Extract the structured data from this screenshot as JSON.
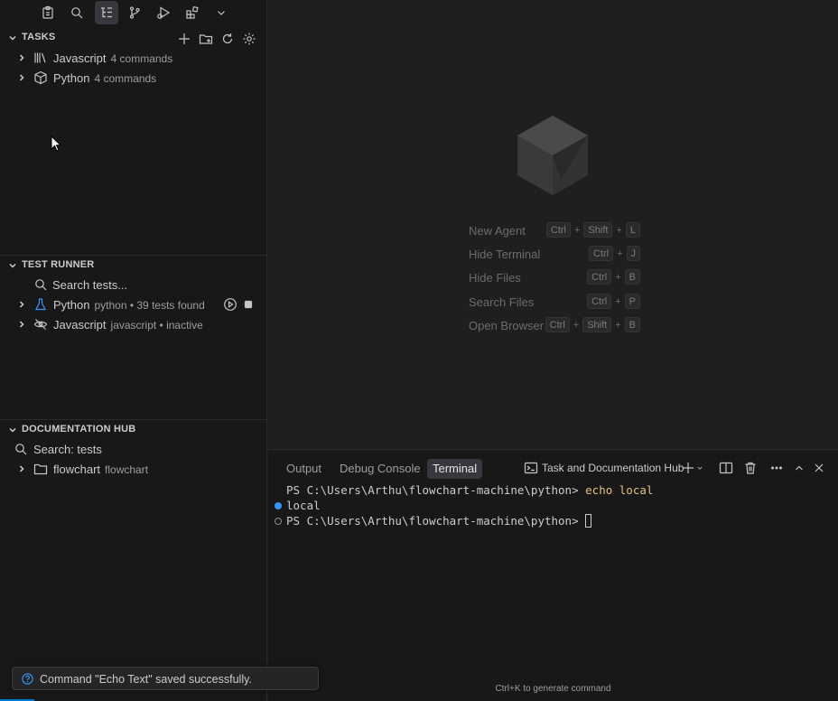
{
  "activity_bar": {
    "icons": [
      "clipboard-icon",
      "search-icon",
      "list-tree-icon",
      "source-control-icon",
      "run-debug-icon",
      "extensions-icon",
      "chevron-down-icon"
    ],
    "active": "list-tree-icon"
  },
  "tasks": {
    "title": "TASKS",
    "actions": [
      "add-icon",
      "new-folder-icon",
      "refresh-icon",
      "gear-icon"
    ],
    "items": [
      {
        "label": "Javascript",
        "desc": "4 commands",
        "icon": "library-icon"
      },
      {
        "label": "Python",
        "desc": "4 commands",
        "icon": "package-icon"
      }
    ]
  },
  "test_runner": {
    "title": "TEST RUNNER",
    "search_label": "Search tests...",
    "items": [
      {
        "label": "Python",
        "desc": "python • 39 tests found",
        "icon": "beaker-icon"
      },
      {
        "label": "Javascript",
        "desc": "javascript • inactive",
        "icon": "eye-closed-icon"
      }
    ]
  },
  "documentation_hub": {
    "title": "DOCUMENTATION HUB",
    "search_label": "Search: tests",
    "items": [
      {
        "label": "flowchart",
        "desc": "flowchart",
        "icon": "folder-icon"
      }
    ]
  },
  "watermark": {
    "shortcuts": [
      {
        "label": "New Agent",
        "keys": [
          "Ctrl",
          "Shift",
          "L"
        ]
      },
      {
        "label": "Hide Terminal",
        "keys": [
          "Ctrl",
          "J"
        ]
      },
      {
        "label": "Hide Files",
        "keys": [
          "Ctrl",
          "B"
        ]
      },
      {
        "label": "Search Files",
        "keys": [
          "Ctrl",
          "P"
        ]
      },
      {
        "label": "Open Browser",
        "keys": [
          "Ctrl",
          "Shift",
          "B"
        ]
      }
    ],
    "plus": "+"
  },
  "panel": {
    "tabs": [
      {
        "label": "Output",
        "active": false
      },
      {
        "label": "Debug Console",
        "active": false
      },
      {
        "label": "Terminal",
        "active": true
      }
    ],
    "terminal_name": "Task and Documentation Hub",
    "lines": [
      {
        "prompt": "PS C:\\Users\\Arthu\\flowchart-machine\\python>",
        "cmd": "echo local"
      },
      {
        "output": "local"
      },
      {
        "prompt": "PS C:\\Users\\Arthu\\flowchart-machine\\python>",
        "cmd": ""
      }
    ],
    "generate_hint": "Ctrl+K to generate command"
  },
  "toast": {
    "message": "Command \"Echo Text\" saved successfully."
  },
  "colors": {
    "accent": "#0078d4",
    "terminal_command": "#e5c07b",
    "deco_success": "#3794ff"
  }
}
